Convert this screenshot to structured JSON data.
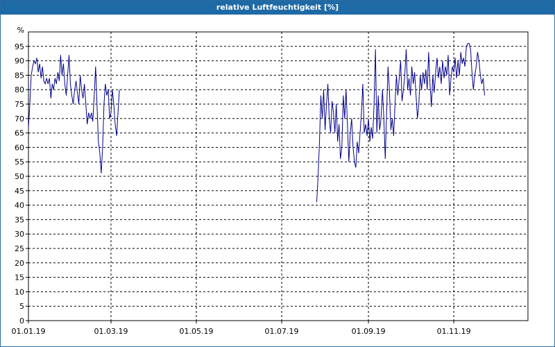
{
  "window": {
    "title": "relative Luftfeuchtigkeit [%]"
  },
  "chart_data": {
    "type": "line",
    "title": "relative Luftfeuchtigkeit [%]",
    "ylabel": "%",
    "xlabel": "",
    "ylim": [
      0,
      100
    ],
    "xlim": [
      "2019-01-01",
      "2019-12-24"
    ],
    "grid": true,
    "y_ticks": [
      0,
      5,
      10,
      15,
      20,
      25,
      30,
      35,
      40,
      45,
      50,
      55,
      60,
      65,
      70,
      75,
      80,
      85,
      90,
      95
    ],
    "x_ticks": [
      {
        "date": "2019-01-01",
        "label": "01.01.19"
      },
      {
        "date": "2019-03-01",
        "label": "01.03.19"
      },
      {
        "date": "2019-05-01",
        "label": "01.05.19"
      },
      {
        "date": "2019-07-01",
        "label": "01.07.19"
      },
      {
        "date": "2019-09-01",
        "label": "01.09.19"
      },
      {
        "date": "2019-11-01",
        "label": "01.11.19"
      }
    ],
    "line_color": "#00008b",
    "series": [
      {
        "segments": [
          [
            [
              "2019-01-01",
              67
            ],
            [
              "2019-01-02",
              75
            ],
            [
              "2019-01-03",
              85
            ],
            [
              "2019-01-04",
              88
            ],
            [
              "2019-01-05",
              90
            ],
            [
              "2019-01-06",
              89
            ],
            [
              "2019-01-07",
              91
            ],
            [
              "2019-01-08",
              86
            ],
            [
              "2019-01-09",
              89
            ],
            [
              "2019-01-10",
              84
            ],
            [
              "2019-01-11",
              88
            ],
            [
              "2019-01-12",
              83
            ],
            [
              "2019-01-13",
              82
            ],
            [
              "2019-01-14",
              84
            ],
            [
              "2019-01-15",
              82
            ],
            [
              "2019-01-16",
              84
            ],
            [
              "2019-01-17",
              77
            ],
            [
              "2019-01-18",
              82
            ],
            [
              "2019-01-19",
              80
            ],
            [
              "2019-01-20",
              84
            ],
            [
              "2019-01-21",
              82
            ],
            [
              "2019-01-22",
              86
            ],
            [
              "2019-01-23",
              83
            ],
            [
              "2019-01-24",
              92
            ],
            [
              "2019-01-25",
              85
            ],
            [
              "2019-01-26",
              89
            ],
            [
              "2019-01-27",
              82
            ],
            [
              "2019-01-28",
              78
            ],
            [
              "2019-01-29",
              85
            ],
            [
              "2019-01-30",
              92
            ],
            [
              "2019-01-31",
              82
            ],
            [
              "2019-02-01",
              78
            ],
            [
              "2019-02-02",
              75
            ],
            [
              "2019-02-03",
              80
            ],
            [
              "2019-02-04",
              83
            ],
            [
              "2019-02-05",
              79
            ],
            [
              "2019-02-06",
              75
            ],
            [
              "2019-02-07",
              85
            ],
            [
              "2019-02-08",
              80
            ],
            [
              "2019-02-09",
              77
            ],
            [
              "2019-02-10",
              82
            ],
            [
              "2019-02-11",
              75
            ],
            [
              "2019-02-12",
              68
            ],
            [
              "2019-02-13",
              72
            ],
            [
              "2019-02-14",
              70
            ],
            [
              "2019-02-15",
              72
            ],
            [
              "2019-02-16",
              69
            ],
            [
              "2019-02-17",
              78
            ],
            [
              "2019-02-18",
              88
            ],
            [
              "2019-02-19",
              75
            ],
            [
              "2019-02-20",
              62
            ],
            [
              "2019-02-21",
              58
            ],
            [
              "2019-02-22",
              51
            ],
            [
              "2019-02-23",
              60
            ],
            [
              "2019-02-24",
              75
            ],
            [
              "2019-02-25",
              82
            ],
            [
              "2019-02-26",
              78
            ],
            [
              "2019-02-27",
              80
            ],
            [
              "2019-02-28",
              70
            ],
            [
              "2019-03-01",
              72
            ],
            [
              "2019-03-02",
              80
            ],
            [
              "2019-03-03",
              75
            ],
            [
              "2019-03-04",
              68
            ],
            [
              "2019-03-05",
              64
            ],
            [
              "2019-03-06",
              72
            ],
            [
              "2019-03-07",
              80
            ]
          ],
          [
            [
              "2019-07-26",
              41
            ],
            [
              "2019-07-27",
              50
            ],
            [
              "2019-07-28",
              62
            ],
            [
              "2019-07-29",
              78
            ],
            [
              "2019-07-30",
              70
            ],
            [
              "2019-07-31",
              80
            ],
            [
              "2019-08-01",
              66
            ],
            [
              "2019-08-02",
              75
            ],
            [
              "2019-08-03",
              82
            ],
            [
              "2019-08-04",
              70
            ],
            [
              "2019-08-05",
              65
            ],
            [
              "2019-08-06",
              76
            ],
            [
              "2019-08-07",
              72
            ],
            [
              "2019-08-08",
              65
            ],
            [
              "2019-08-09",
              75
            ],
            [
              "2019-08-10",
              62
            ],
            [
              "2019-08-11",
              68
            ],
            [
              "2019-08-12",
              56
            ],
            [
              "2019-08-13",
              60
            ],
            [
              "2019-08-14",
              78
            ],
            [
              "2019-08-15",
              70
            ],
            [
              "2019-08-16",
              80
            ],
            [
              "2019-08-17",
              68
            ],
            [
              "2019-08-18",
              55
            ],
            [
              "2019-08-19",
              65
            ],
            [
              "2019-08-20",
              70
            ],
            [
              "2019-08-21",
              60
            ],
            [
              "2019-08-22",
              55
            ],
            [
              "2019-08-23",
              53
            ],
            [
              "2019-08-24",
              62
            ],
            [
              "2019-08-25",
              58
            ],
            [
              "2019-08-26",
              65
            ],
            [
              "2019-08-27",
              72
            ],
            [
              "2019-08-28",
              82
            ],
            [
              "2019-08-29",
              65
            ],
            [
              "2019-08-30",
              68
            ],
            [
              "2019-08-31",
              64
            ],
            [
              "2019-09-01",
              70
            ],
            [
              "2019-09-02",
              62
            ],
            [
              "2019-09-03",
              67
            ],
            [
              "2019-09-04",
              63
            ],
            [
              "2019-09-05",
              75
            ],
            [
              "2019-09-06",
              94
            ],
            [
              "2019-09-07",
              65
            ],
            [
              "2019-09-08",
              78
            ],
            [
              "2019-09-09",
              66
            ],
            [
              "2019-09-10",
              70
            ],
            [
              "2019-09-11",
              80
            ],
            [
              "2019-09-12",
              70
            ],
            [
              "2019-09-13",
              56
            ],
            [
              "2019-09-14",
              72
            ],
            [
              "2019-09-15",
              88
            ],
            [
              "2019-09-16",
              80
            ],
            [
              "2019-09-17",
              66
            ],
            [
              "2019-09-18",
              70
            ],
            [
              "2019-09-19",
              64
            ],
            [
              "2019-09-20",
              75
            ],
            [
              "2019-09-21",
              85
            ],
            [
              "2019-09-22",
              78
            ],
            [
              "2019-09-23",
              84
            ],
            [
              "2019-09-24",
              90
            ],
            [
              "2019-09-25",
              76
            ],
            [
              "2019-09-26",
              80
            ],
            [
              "2019-09-27",
              85
            ],
            [
              "2019-09-28",
              94
            ],
            [
              "2019-09-29",
              80
            ],
            [
              "2019-09-30",
              84
            ],
            [
              "2019-10-01",
              78
            ],
            [
              "2019-10-02",
              88
            ],
            [
              "2019-10-03",
              82
            ],
            [
              "2019-10-04",
              86
            ],
            [
              "2019-10-05",
              78
            ],
            [
              "2019-10-06",
              70
            ],
            [
              "2019-10-07",
              75
            ],
            [
              "2019-10-08",
              85
            ],
            [
              "2019-10-09",
              80
            ],
            [
              "2019-10-10",
              86
            ],
            [
              "2019-10-11",
              82
            ],
            [
              "2019-10-12",
              87
            ],
            [
              "2019-10-13",
              80
            ],
            [
              "2019-10-14",
              93
            ],
            [
              "2019-10-15",
              82
            ],
            [
              "2019-10-16",
              74
            ],
            [
              "2019-10-17",
              85
            ],
            [
              "2019-10-18",
              79
            ],
            [
              "2019-10-19",
              86
            ],
            [
              "2019-10-20",
              91
            ],
            [
              "2019-10-21",
              84
            ],
            [
              "2019-10-22",
              88
            ],
            [
              "2019-10-23",
              82
            ],
            [
              "2019-10-24",
              90
            ],
            [
              "2019-10-25",
              84
            ],
            [
              "2019-10-26",
              88
            ],
            [
              "2019-10-27",
              85
            ],
            [
              "2019-10-28",
              92
            ],
            [
              "2019-10-29",
              78
            ],
            [
              "2019-10-30",
              84
            ],
            [
              "2019-10-31",
              88
            ],
            [
              "2019-11-01",
              86
            ],
            [
              "2019-11-02",
              91
            ],
            [
              "2019-11-03",
              84
            ],
            [
              "2019-11-04",
              90
            ],
            [
              "2019-11-05",
              85
            ],
            [
              "2019-11-06",
              93
            ],
            [
              "2019-11-07",
              89
            ],
            [
              "2019-11-08",
              91
            ],
            [
              "2019-11-09",
              88
            ],
            [
              "2019-11-10",
              95
            ],
            [
              "2019-11-11",
              96
            ],
            [
              "2019-11-12",
              96
            ],
            [
              "2019-11-13",
              94
            ],
            [
              "2019-11-14",
              86
            ],
            [
              "2019-11-15",
              80
            ],
            [
              "2019-11-16",
              85
            ],
            [
              "2019-11-17",
              88
            ],
            [
              "2019-11-18",
              93
            ],
            [
              "2019-11-19",
              90
            ],
            [
              "2019-11-20",
              85
            ],
            [
              "2019-11-21",
              82
            ],
            [
              "2019-11-22",
              84
            ],
            [
              "2019-11-23",
              78
            ]
          ]
        ]
      }
    ]
  }
}
